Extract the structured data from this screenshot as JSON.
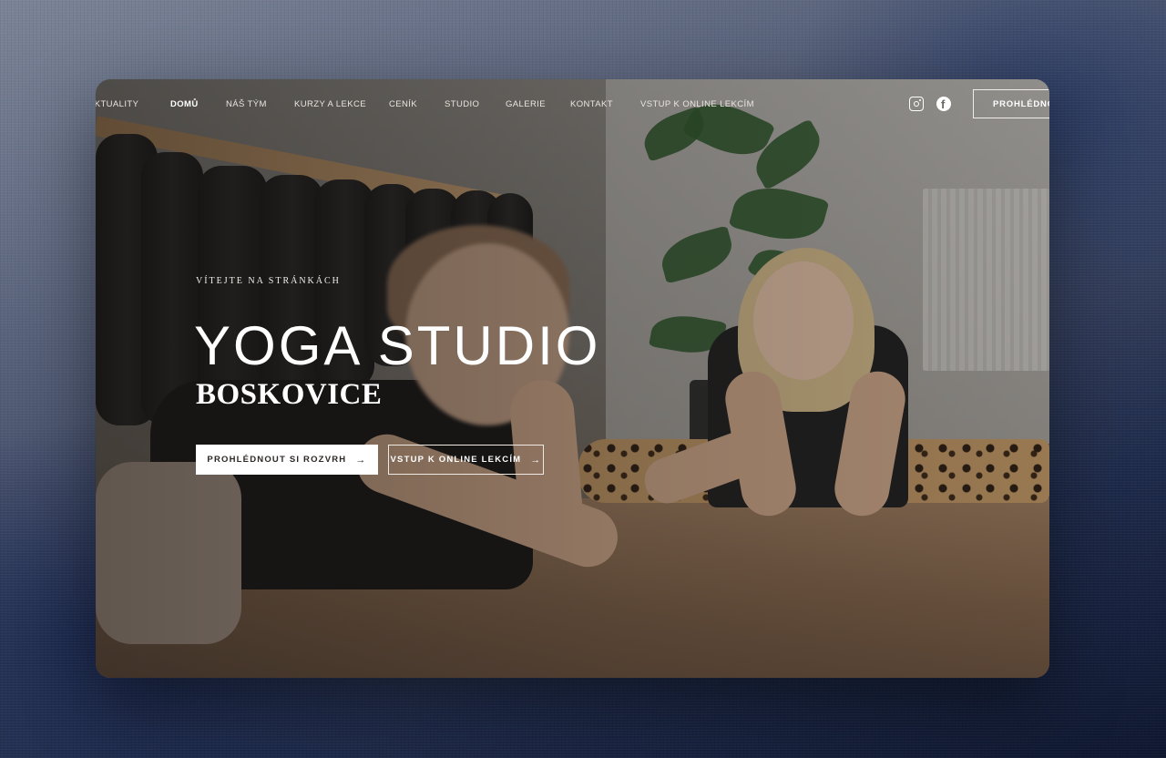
{
  "nav": {
    "items": [
      {
        "label": "AKTUALITY",
        "active": false
      },
      {
        "label": "DOMŮ",
        "active": true
      },
      {
        "label": "NÁŠ TÝM",
        "active": false
      },
      {
        "label": "KURZY A LEKCE",
        "active": false
      },
      {
        "label": "CENÍK",
        "active": false
      },
      {
        "label": "STUDIO",
        "active": false
      },
      {
        "label": "GALERIE",
        "active": false
      },
      {
        "label": "KONTAKT",
        "active": false
      },
      {
        "label": "VSTUP K ONLINE LEKCÍM",
        "active": false
      }
    ],
    "social": [
      "instagram-icon",
      "facebook-icon"
    ],
    "cta_label": "PROHLÉDNOUT SI ROZVRH"
  },
  "hero": {
    "eyebrow": "VÍTEJTE NA STRÁNKÁCH",
    "title": "YOGA STUDIO",
    "subtitle": "BOSKOVICE",
    "primary_button": "PROHLÉDNOUT SI ROZVRH",
    "secondary_button": "VSTUP K ONLINE LEKCÍM",
    "arrow": "→"
  },
  "colors": {
    "overlay": "#19161499",
    "button_bg": "#ffffff",
    "button_text": "#2c2825"
  }
}
